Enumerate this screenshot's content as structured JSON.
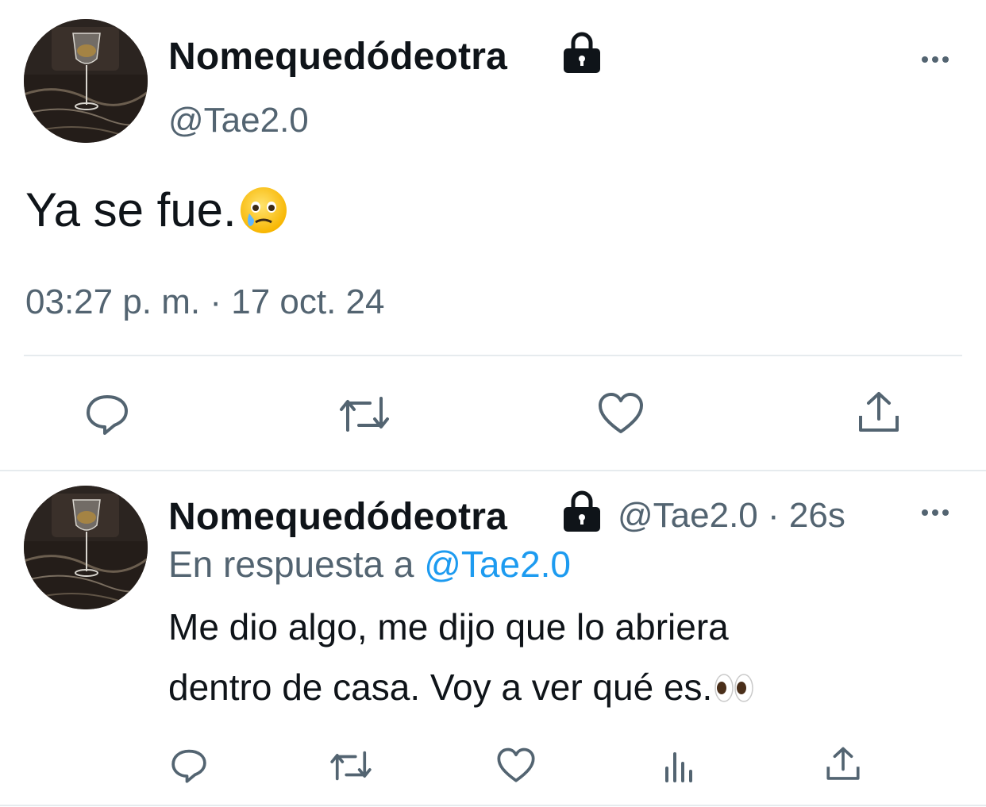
{
  "main_tweet": {
    "display_name": "Nomequedódeotra",
    "handle": "@Tae2.0",
    "text": "Ya se fue.",
    "timestamp": "03:27 p. m. · 17 oct. 24",
    "text_emoji": "face-holding-back-tears-emoji"
  },
  "reply_tweet": {
    "display_name": "Nomequedódeotra",
    "handle": "@Tae2.0",
    "separator": "·",
    "age": "26s",
    "reply_prefix": "En respuesta a",
    "reply_target": "@Tae2.0",
    "line1": "Me dio algo, me dijo que lo abriera",
    "line2": "dentro de casa. Voy a ver qué es.",
    "text_emoji": "eyes-emoji"
  },
  "icons": {
    "lock": "lock-icon",
    "more": "more-icon",
    "reply": "reply-icon",
    "retweet": "retweet-icon",
    "like": "heart-icon",
    "views": "views-icon",
    "share": "share-icon"
  },
  "colors": {
    "text": "#0f1419",
    "secondary": "#536471",
    "link": "#1d9bf0",
    "divider": "#e6ebee"
  }
}
